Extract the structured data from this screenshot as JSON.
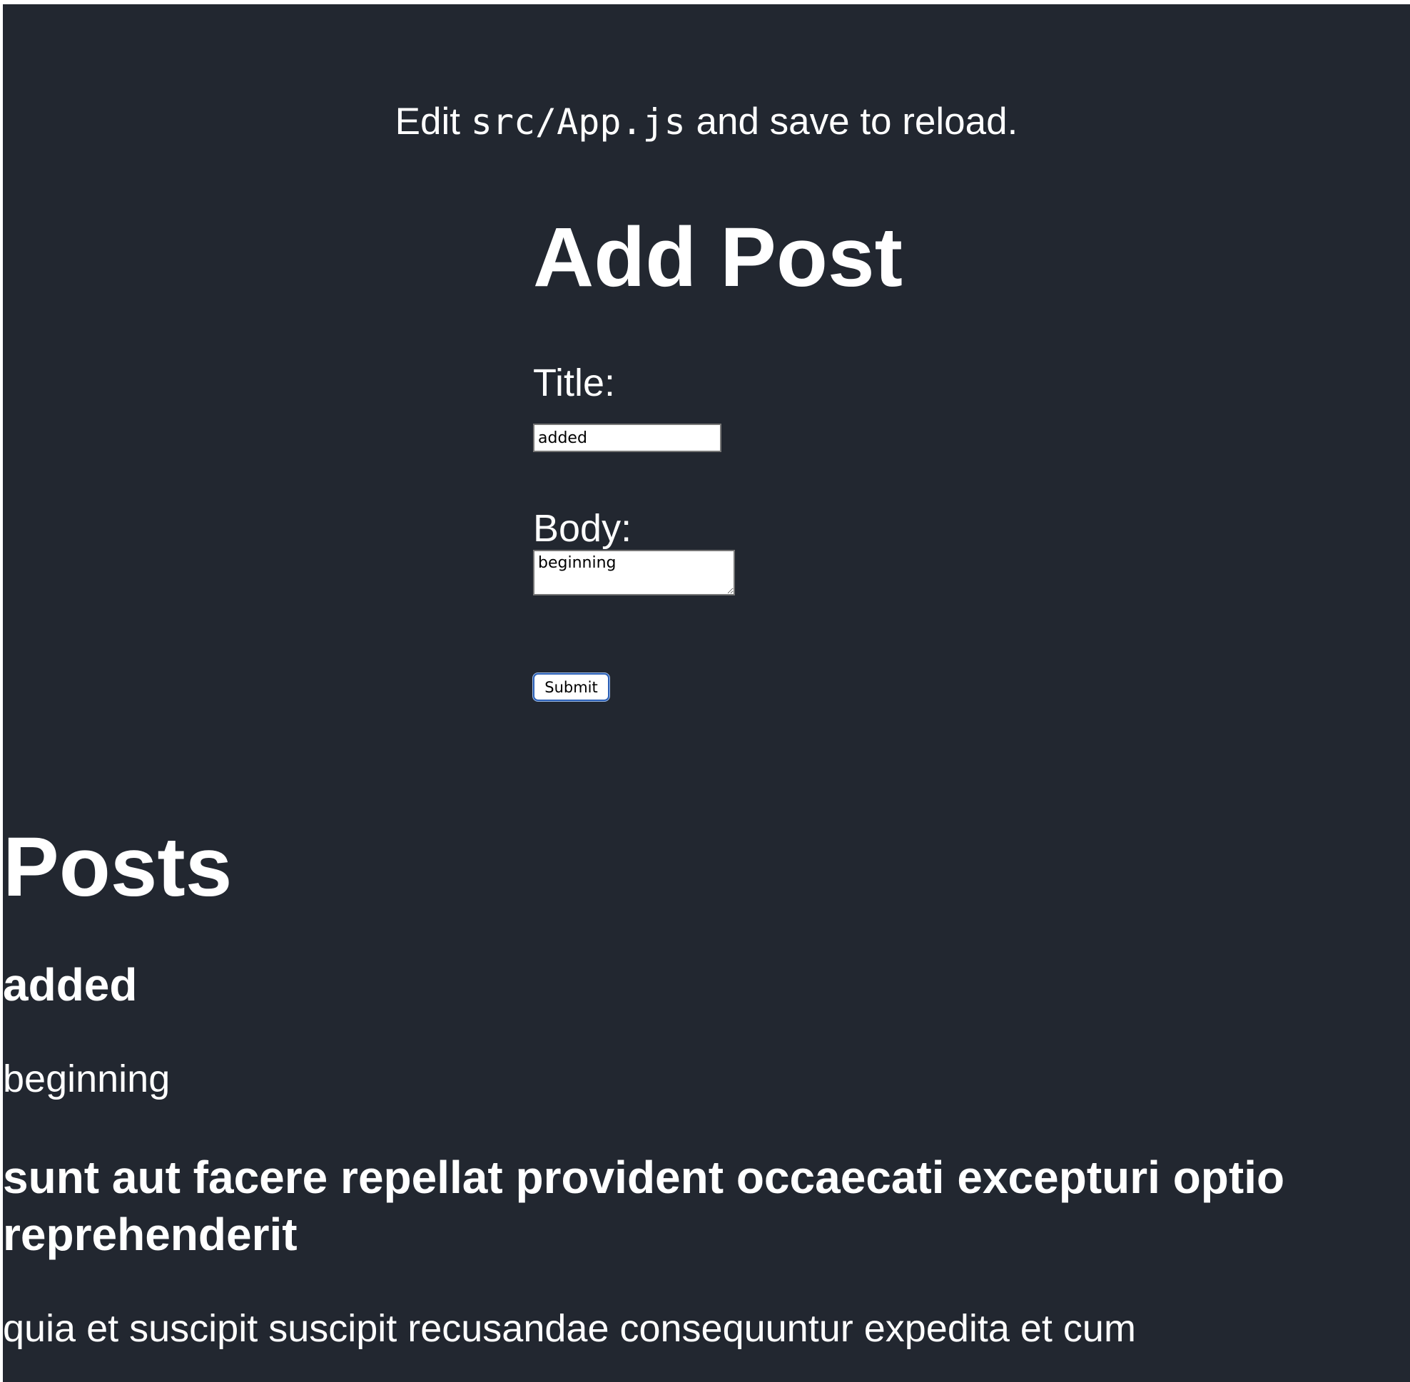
{
  "header": {
    "edit_prefix": "Edit",
    "edit_code": "src/App.js",
    "edit_suffix": "and save to reload."
  },
  "form": {
    "heading": "Add Post",
    "title_label": "Title:",
    "title_value": "added",
    "body_label": "Body:",
    "body_value": "beginning",
    "submit_label": "Submit"
  },
  "posts": {
    "heading": "Posts",
    "items": [
      {
        "title": "added",
        "body": "beginning"
      },
      {
        "title": "sunt aut facere repellat provident occaecati excepturi optio reprehenderit",
        "body": "quia et suscipit suscipit recusandae consequuntur expedita et cum"
      }
    ]
  },
  "colors": {
    "background": "#222730",
    "text": "#ffffff",
    "button_border": "#2b5fb5"
  }
}
